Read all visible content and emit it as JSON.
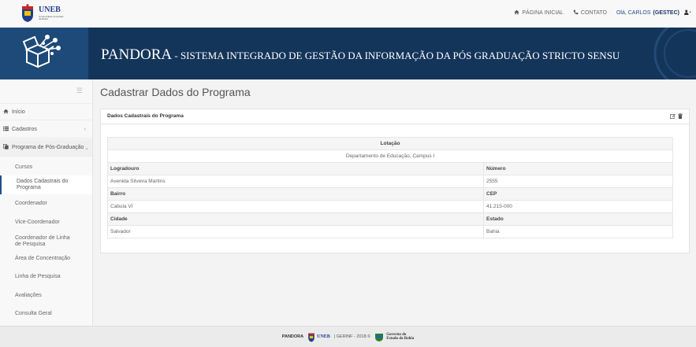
{
  "header": {
    "logo_name": "UNEB",
    "logo_subtitle": "Universidade do Estado da Bahia",
    "nav_home": "PÁGINA INICIAL",
    "nav_contact": "CONTATO",
    "greeting": "Olá, CARLOS",
    "user_group": "(GESTEC)"
  },
  "banner": {
    "title_main": "PANDORA",
    "title_rest": " - SISTEMA INTEGRADO DE GESTÃO DA INFORMAÇÃO DA PÓS GRADUAÇÃO STRICTO SENSU"
  },
  "sidebar": {
    "items": [
      {
        "label": "Início",
        "icon": "home-icon"
      },
      {
        "label": "Cadastros",
        "icon": "list-icon"
      },
      {
        "label": "Programa de Pós-Graduação",
        "icon": "copy-icon"
      }
    ],
    "subitems": [
      "Cursos",
      "Dados Cadastrais do Programa",
      "Coordenador",
      "Vice-Coordenador",
      "Coordenador de Linha de Pesquisa",
      "Área de Concentração",
      "Linha de Pesquisa",
      "Avaliações",
      "Consulta Geral"
    ]
  },
  "main": {
    "page_title": "Cadastrar Dados do Programa",
    "panel_title": "Dados Cadastrais do Programa",
    "table": {
      "lotacao_label": "Lotação",
      "lotacao_value": "Departamento de Educação, Campus I",
      "logradouro_label": "Logradouro",
      "logradouro_value": "Avenida Silveira Martins",
      "numero_label": "Número",
      "numero_value": "2555",
      "bairro_label": "Bairro",
      "bairro_value": "Cabula VI",
      "cep_label": "CEP",
      "cep_value": "41.215-000",
      "cidade_label": "Cidade",
      "cidade_value": "Salvador",
      "estado_label": "Estado",
      "estado_value": "Bahia"
    }
  },
  "footer": {
    "brand": "PANDORA",
    "logo_name": "UNEB",
    "copyright": "| GERINF - 2018 ©",
    "gov_line1": "Governo do",
    "gov_line2": "Estado da Bahia"
  },
  "colors": {
    "topbar_bg": "#f8f8f8",
    "banner_bg": "#14355a",
    "accent": "#1f4e8c",
    "sidebar_bg": "#f8f8f8",
    "content_bg": "#f3f3f3"
  }
}
